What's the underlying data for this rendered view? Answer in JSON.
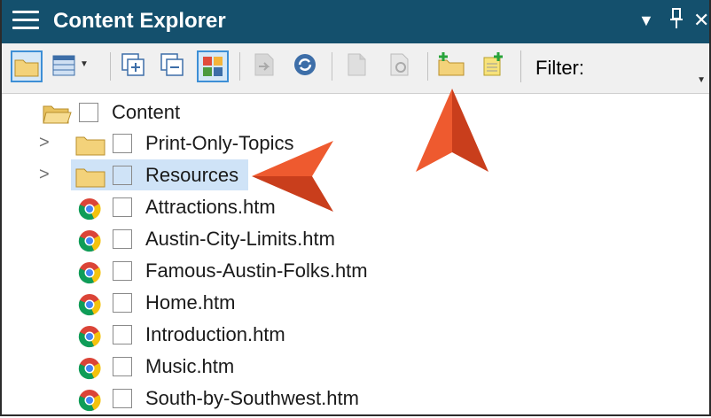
{
  "panel": {
    "title": "Content Explorer",
    "menu_icon": "hamburger-icon",
    "controls": {
      "dropdown_glyph": "▼",
      "pin_glyph": "ᛘ",
      "close_glyph": "✕"
    }
  },
  "toolbar": {
    "filter_label": "Filter:",
    "buttons": [
      {
        "icon": "folder-icon",
        "pressed": true
      },
      {
        "icon": "table-view-icon",
        "has_dropdown": true
      },
      {
        "icon": "expand-all-icon"
      },
      {
        "icon": "collapse-all-icon"
      },
      {
        "icon": "color-grid-icon",
        "pressed": true
      },
      {
        "icon": "file-move-icon",
        "disabled": true
      },
      {
        "icon": "refresh-icon"
      },
      {
        "icon": "document-icon",
        "disabled": true
      },
      {
        "icon": "document-settings-icon",
        "disabled": true
      },
      {
        "icon": "new-folder-icon"
      },
      {
        "icon": "new-file-icon"
      }
    ]
  },
  "tree": {
    "root": {
      "label": "Content",
      "icon": "open-folder-icon"
    },
    "items": [
      {
        "label": "Print-Only-Topics",
        "type": "folder",
        "expandable": true
      },
      {
        "label": "Resources",
        "type": "folder",
        "expandable": true,
        "selected": true
      },
      {
        "label": "Attractions.htm",
        "type": "file"
      },
      {
        "label": "Austin-City-Limits.htm",
        "type": "file"
      },
      {
        "label": "Famous-Austin-Folks.htm",
        "type": "file"
      },
      {
        "label": "Home.htm",
        "type": "file"
      },
      {
        "label": "Introduction.htm",
        "type": "file"
      },
      {
        "label": "Music.htm",
        "type": "file"
      },
      {
        "label": "South-by-Southwest.htm",
        "type": "file"
      }
    ]
  },
  "colors": {
    "titlebar": "#14506d",
    "selection": "#cfe3f7",
    "annotation_arrow": "#e8502a"
  }
}
